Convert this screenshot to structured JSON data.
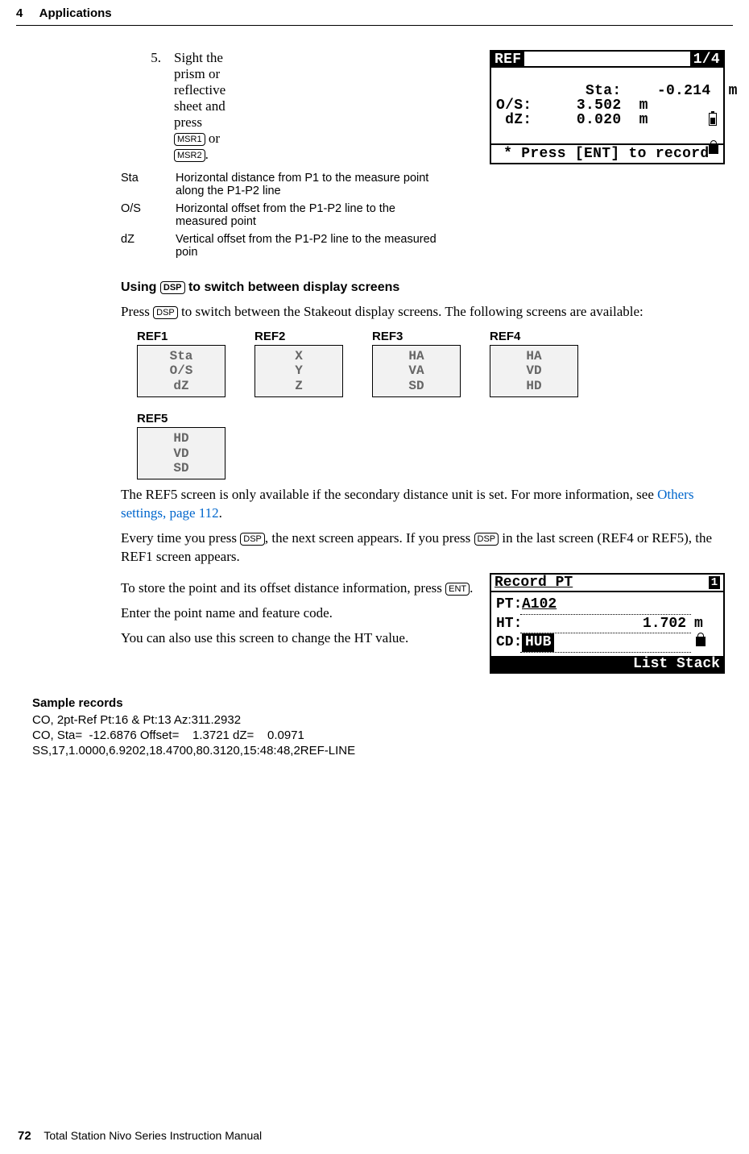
{
  "header": {
    "chapter_num": "4",
    "chapter_title": "Applications"
  },
  "step": {
    "num": "5.",
    "text_a": "Sight the prism or reflective sheet and press ",
    "key1": "MSR1",
    "mid": " or ",
    "key2": "MSR2",
    "text_b": "."
  },
  "defs": [
    {
      "term": "Sta",
      "desc": "Horizontal distance from P1 to the measure point along the P1-P2 line"
    },
    {
      "term": "O/S",
      "desc": "Horizontal offset from the P1-P2 line to the measured point"
    },
    {
      "term": "dZ",
      "desc": "Vertical offset from the P1-P2 line to the measured poin"
    }
  ],
  "lcd_ref": {
    "title_left": "REF",
    "title_right": "1/4",
    "lines": "Sta:    -0.214  m\nO/S:     3.502  m\n dZ:     0.020  m",
    "footer": " * Press [ENT] to record"
  },
  "sub": {
    "pre": "Using ",
    "key": "DSP",
    "post": " to switch between display screens"
  },
  "para1": {
    "pre": "Press ",
    "key": "DSP",
    "post": " to switch between the Stakeout display screens. The following screens are available:"
  },
  "refs": [
    {
      "label": "REF1",
      "lines": [
        "Sta",
        "O/S",
        "dZ"
      ]
    },
    {
      "label": "REF2",
      "lines": [
        "X",
        "Y",
        "Z"
      ]
    },
    {
      "label": "REF3",
      "lines": [
        "HA",
        "VA",
        "SD"
      ]
    },
    {
      "label": "REF4",
      "lines": [
        "HA",
        "VD",
        "HD"
      ]
    },
    {
      "label": "REF5",
      "lines": [
        "HD",
        "VD",
        "SD"
      ]
    }
  ],
  "para2": {
    "pre": "The REF5 screen is only available if the secondary distance unit is set. For more information, see ",
    "link": "Others settings, page 112",
    "post": "."
  },
  "para3": {
    "a": "Every time you press ",
    "key1": "DSP",
    "b": ", the next screen appears. If you press ",
    "key2": "DSP",
    "c": " in the last screen (REF4 or REF5), the REF1 screen appears."
  },
  "para4": {
    "a": "To store the point and its offset distance information, press ",
    "key": "ENT",
    "b": "."
  },
  "para5": "Enter the point name and feature code.",
  "para6": "You can also use this screen to change the HT value.",
  "lcd_record": {
    "title": "Record PT",
    "badge": "1",
    "pt_label": "PT:",
    "pt_val": "A102",
    "ht_label": "HT:",
    "ht_val": "1.702",
    "ht_unit": "m",
    "cd_label": "CD:",
    "cd_val": "HUB",
    "bottom": "List Stack"
  },
  "sample": {
    "title": "Sample records",
    "lines": [
      "CO, 2pt-Ref Pt:16 & Pt:13 Az:311.2932",
      "CO, Sta=  -12.6876 Offset=    1.3721 dZ=    0.0971",
      "SS,17,1.0000,6.9202,18.4700,80.3120,15:48:48,2REF-LINE"
    ]
  },
  "footer": {
    "page": "72",
    "title": "Total Station Nivo Series Instruction Manual"
  }
}
